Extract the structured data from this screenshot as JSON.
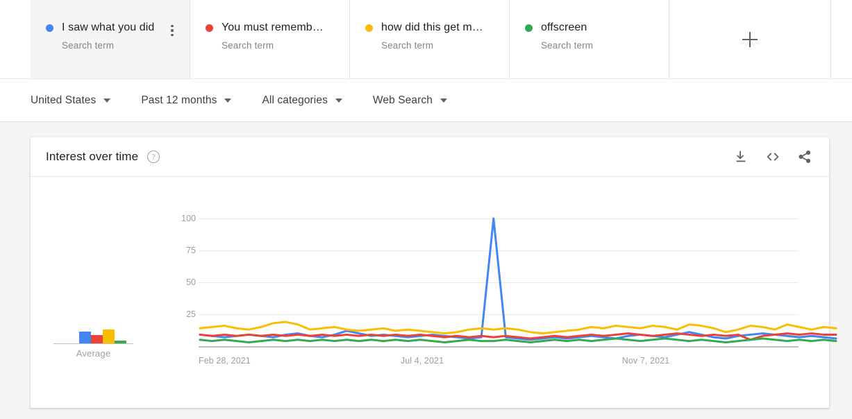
{
  "terms": [
    {
      "name": "I saw what you did",
      "subtitle": "Search term",
      "color": "#4285F4",
      "selected": true,
      "menu_icon": "kebab-menu-icon"
    },
    {
      "name": "You must rememb…",
      "subtitle": "Search term",
      "color": "#EA4335",
      "selected": false,
      "menu_icon": "kebab-menu-icon"
    },
    {
      "name": "how did this get m…",
      "subtitle": "Search term",
      "color": "#FBBC04",
      "selected": false,
      "menu_icon": "kebab-menu-icon"
    },
    {
      "name": "offscreen",
      "subtitle": "Search term",
      "color": "#34A853",
      "selected": false,
      "menu_icon": "kebab-menu-icon"
    }
  ],
  "add_term": {
    "icon": "plus-icon",
    "label": "+"
  },
  "filters": [
    {
      "label": "United States",
      "icon": "chevron-down-icon"
    },
    {
      "label": "Past 12 months",
      "icon": "chevron-down-icon"
    },
    {
      "label": "All categories",
      "icon": "chevron-down-icon"
    },
    {
      "label": "Web Search",
      "icon": "chevron-down-icon"
    }
  ],
  "card": {
    "title": "Interest over time",
    "help_icon": "help-circle-icon",
    "help_glyph": "?",
    "actions": [
      {
        "name": "download-icon",
        "tooltip": "Download"
      },
      {
        "name": "embed-code-icon",
        "tooltip": "Embed"
      },
      {
        "name": "share-icon",
        "tooltip": "Share"
      }
    ]
  },
  "average_panel": {
    "label": "Average",
    "values": [
      17,
      12,
      20,
      4
    ],
    "colors": [
      "#4285F4",
      "#EA4335",
      "#FBBC04",
      "#34A853"
    ]
  },
  "chart_data": {
    "type": "line",
    "title": "Interest over time",
    "xlabel": "",
    "ylabel": "",
    "ylim": [
      0,
      100
    ],
    "yticks": [
      100,
      75,
      50,
      25
    ],
    "grid": true,
    "legend": "top-cards",
    "xtick_labels": [
      "Feb 28, 2021",
      "Jul 4, 2021",
      "Nov 7, 2021"
    ],
    "xtick_positions": [
      0.0,
      0.355,
      0.705
    ],
    "n_points": 53,
    "series": [
      {
        "name": "I saw what you did",
        "color": "#4285F4",
        "values": [
          9,
          8,
          7,
          8,
          9,
          8,
          7,
          9,
          10,
          8,
          7,
          9,
          12,
          10,
          8,
          9,
          8,
          7,
          8,
          9,
          8,
          7,
          6,
          7,
          100,
          7,
          6,
          5,
          6,
          7,
          6,
          7,
          8,
          7,
          6,
          8,
          9,
          8,
          7,
          9,
          11,
          9,
          7,
          6,
          8,
          9,
          10,
          9,
          8,
          7,
          8,
          7,
          6
        ]
      },
      {
        "name": "You must remember this",
        "color": "#EA4335",
        "values": [
          9,
          8,
          9,
          8,
          9,
          8,
          9,
          8,
          9,
          8,
          9,
          8,
          9,
          8,
          9,
          8,
          9,
          8,
          9,
          8,
          7,
          8,
          7,
          8,
          7,
          8,
          7,
          6,
          7,
          8,
          7,
          8,
          9,
          8,
          9,
          10,
          9,
          8,
          9,
          10,
          9,
          8,
          9,
          8,
          9,
          5,
          8,
          9,
          10,
          9,
          10,
          9,
          9
        ]
      },
      {
        "name": "how did this get made",
        "color": "#FBBC04",
        "values": [
          14,
          15,
          16,
          14,
          13,
          15,
          18,
          19,
          17,
          13,
          14,
          15,
          13,
          12,
          13,
          14,
          12,
          13,
          12,
          11,
          10,
          11,
          13,
          14,
          13,
          14,
          13,
          11,
          10,
          11,
          12,
          13,
          15,
          14,
          16,
          15,
          14,
          16,
          15,
          13,
          17,
          16,
          14,
          11,
          13,
          16,
          15,
          13,
          17,
          15,
          13,
          15,
          14
        ]
      },
      {
        "name": "offscreen",
        "color": "#34A853",
        "values": [
          5,
          4,
          5,
          4,
          3,
          4,
          5,
          4,
          5,
          4,
          5,
          4,
          5,
          4,
          5,
          4,
          5,
          4,
          5,
          4,
          3,
          4,
          5,
          4,
          4,
          5,
          4,
          3,
          4,
          5,
          4,
          5,
          4,
          5,
          6,
          5,
          4,
          5,
          6,
          5,
          4,
          5,
          4,
          3,
          4,
          5,
          6,
          5,
          4,
          5,
          4,
          5,
          4
        ]
      }
    ]
  }
}
